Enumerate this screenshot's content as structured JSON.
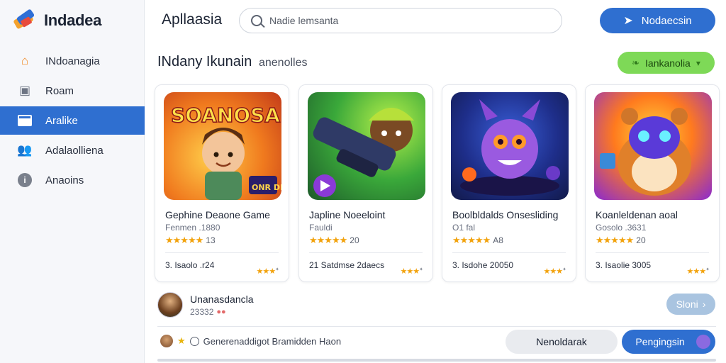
{
  "brand": {
    "name": "Indadea"
  },
  "sidebar": {
    "items": [
      {
        "label": "INdoanagia",
        "icon": "home-icon",
        "active": false
      },
      {
        "label": "Roam",
        "icon": "room-icon",
        "active": false
      },
      {
        "label": "Aralike",
        "icon": "mail-icon",
        "active": true
      },
      {
        "label": "Adalaolliena",
        "icon": "users-icon",
        "active": false
      },
      {
        "label": "Anaoins",
        "icon": "info-icon",
        "active": false
      }
    ]
  },
  "header": {
    "title": "Apllaasia",
    "search_placeholder": "Nadie lemsanta",
    "primary_button": "Nodaecsin"
  },
  "section": {
    "title": "INdany Ikunain",
    "subtitle": "anenolles",
    "filter_button": "Iankanolia"
  },
  "cards": [
    {
      "title": "Gephine Deaone Game",
      "sub": "Fenmen .1880",
      "rating": "13",
      "stars": "★★★★★",
      "foot": "3. Isaolo .r24",
      "foot_stars": "★★★"
    },
    {
      "title": "Japline Noeeloint",
      "sub": "Fauldi",
      "rating": "20",
      "stars": "★★★★★",
      "foot": "21 Satdmse 2daecs",
      "foot_stars": "★★★"
    },
    {
      "title": "Boolbldalds Onsesliding",
      "sub": "O1 fal",
      "rating": "A8",
      "stars": "★★★★★",
      "foot": "3. Isdohe 20050",
      "foot_stars": "★★★"
    },
    {
      "title": "Koanleldenan aoal",
      "sub": "Gosolo .3631",
      "rating": "20",
      "stars": "★★★★★",
      "foot": "3. Isaolie 3005",
      "foot_stars": "★★★"
    }
  ],
  "thumb_texts": [
    "SOANOSAI",
    "ONR DIIAK"
  ],
  "user": {
    "name": "Unanasdancla",
    "meta": "23332"
  },
  "next_button": "Sloni",
  "footer": {
    "text": "Generenaddigot Bramidden Haon"
  },
  "secondary_button": "Nenoldarak",
  "confirm_button": "Pengingsin",
  "colors": {
    "accent": "#2f6fd0",
    "green": "#7ed957",
    "star": "#f2a20c"
  }
}
